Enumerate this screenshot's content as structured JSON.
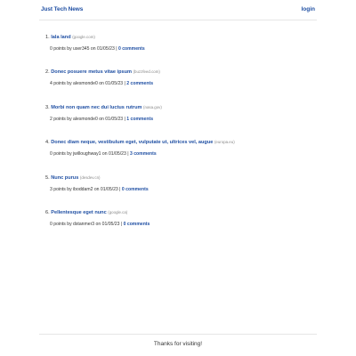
{
  "header": {
    "site_title": "Just Tech News",
    "login_label": "login"
  },
  "stories": [
    {
      "rank": "1.",
      "title": "lala land",
      "domain": "(google.com)",
      "meta_prefix": "0 points by user345 on 01/05/23 |",
      "comments_label": "0 comments"
    },
    {
      "rank": "2.",
      "title": "Donec posuere metus vitae ipsum",
      "domain": "(buzzfeed.com)",
      "meta_prefix": "4 points by alesmonde0 on 01/05/23 |",
      "comments_label": "2 comments"
    },
    {
      "rank": "3.",
      "title": "Morbi non quam nec dui luctus rutrum",
      "domain": "(nasa.gov)",
      "meta_prefix": "2 points by alesmonde0 on 01/05/23 |",
      "comments_label": "1 comments"
    },
    {
      "rank": "4.",
      "title": "Donec diam neque, vestibulum eget, vulputate ut, ultrices vel, augue",
      "domain": "(europa.eu)",
      "meta_prefix": "0 points by jwilloughway1 on 01/05/23 |",
      "comments_label": "3 comments"
    },
    {
      "rank": "5.",
      "title": "Nunc purus",
      "domain": "(desdev.cn)",
      "meta_prefix": "3 points by iboddam2 on 01/05/23 |",
      "comments_label": "0 comments"
    },
    {
      "rank": "6.",
      "title": "Pellentesque eget nunc",
      "domain": "(google.ca)",
      "meta_prefix": "0 points by dstanmer3 on 01/05/23 |",
      "comments_label": "0 comments"
    }
  ],
  "footer": {
    "text": "Thanks for visiting!"
  },
  "colors": {
    "link": "#1f4fa3",
    "domain": "#888888",
    "text": "#333333"
  }
}
